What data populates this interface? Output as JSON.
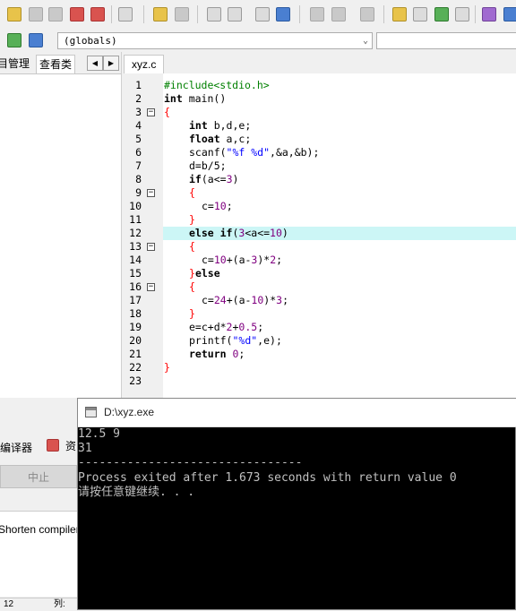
{
  "toolbar": {
    "icons": [
      "new-file-icon",
      "open-icon",
      "save-all-icon",
      "close-icon",
      "close-all-icon",
      "print-icon",
      "undo-icon",
      "redo-icon",
      "find-icon",
      "replace-icon",
      "goto-icon",
      "indent-icon",
      "bookmark-icon",
      "back-icon",
      "forward-icon",
      "compile-icon",
      "run-icon",
      "compile-run-icon",
      "rebuild-icon",
      "check-icon",
      "debug-icon"
    ]
  },
  "scope_selector": {
    "value": "(globals)"
  },
  "left_panel": {
    "tab1": "目管理",
    "tab2": "查看类"
  },
  "editor": {
    "tab": "xyz.c",
    "highlighted_line": 12,
    "lines": [
      {
        "n": "1",
        "fold": ""
      },
      {
        "n": "2",
        "fold": ""
      },
      {
        "n": "3",
        "fold": "−"
      },
      {
        "n": "4",
        "fold": ""
      },
      {
        "n": "5",
        "fold": ""
      },
      {
        "n": "6",
        "fold": ""
      },
      {
        "n": "7",
        "fold": ""
      },
      {
        "n": "8",
        "fold": ""
      },
      {
        "n": "9",
        "fold": "−"
      },
      {
        "n": "10",
        "fold": ""
      },
      {
        "n": "11",
        "fold": ""
      },
      {
        "n": "12",
        "fold": ""
      },
      {
        "n": "13",
        "fold": "−"
      },
      {
        "n": "14",
        "fold": ""
      },
      {
        "n": "15",
        "fold": ""
      },
      {
        "n": "16",
        "fold": "−"
      },
      {
        "n": "17",
        "fold": ""
      },
      {
        "n": "18",
        "fold": ""
      },
      {
        "n": "19",
        "fold": ""
      },
      {
        "n": "20",
        "fold": ""
      },
      {
        "n": "21",
        "fold": ""
      },
      {
        "n": "22",
        "fold": ""
      },
      {
        "n": "23",
        "fold": ""
      }
    ],
    "code": {
      "l1": "#include<stdio.h>",
      "l2a": "int",
      "l2b": " main()",
      "l3": "{",
      "l4a": "int",
      "l4b": " b,d,e;",
      "l5a": "float",
      "l5b": " a,c;",
      "l6a": "scanf(",
      "l6b": "\"%f %d\"",
      "l6c": ",&a,&b);",
      "l7": "d=b/5;",
      "l8a": "if",
      "l8b": "(a<=",
      "l8c": "3",
      "l8d": ")",
      "l9": "{",
      "l10a": "c=",
      "l10b": "10",
      "l10c": ";",
      "l11": "}",
      "l12a": "else if",
      "l12b": "(",
      "l12c": "3",
      "l12d": "<a<=",
      "l12e": "10",
      "l12f": ")",
      "l13": "{",
      "l14a": "c=",
      "l14b": "10",
      "l14c": "+(a-",
      "l14d": "3",
      "l14e": ")*",
      "l14f": "2",
      "l14g": ";",
      "l15a": "}",
      "l15b": "else",
      "l16": "{",
      "l17a": "c=",
      "l17b": "24",
      "l17c": "+(a-",
      "l17d": "10",
      "l17e": ")*",
      "l17f": "3",
      "l17g": ";",
      "l18": "}",
      "l19a": "e=c+d*",
      "l19b": "2",
      "l19c": "+",
      "l19d": "0.5",
      "l19e": ";",
      "l20a": "printf(",
      "l20b": "\"%d\"",
      "l20c": ",e);",
      "l21a": "return",
      "l21b": " ",
      "l21c": "0",
      "l21d": ";",
      "l22": "}"
    }
  },
  "bottom_panel": {
    "tab_compiler": "编译器",
    "tab_resources": "资",
    "stop_button": "中止",
    "shorten_label": "Shorten compiler",
    "status_line": "12",
    "status_col": "列:"
  },
  "console": {
    "title": "D:\\xyz.exe",
    "lines": [
      "12.5 9",
      "31",
      "--------------------------------",
      "Process exited after 1.673 seconds with return value 0",
      "请按任意键继续. . ."
    ]
  }
}
